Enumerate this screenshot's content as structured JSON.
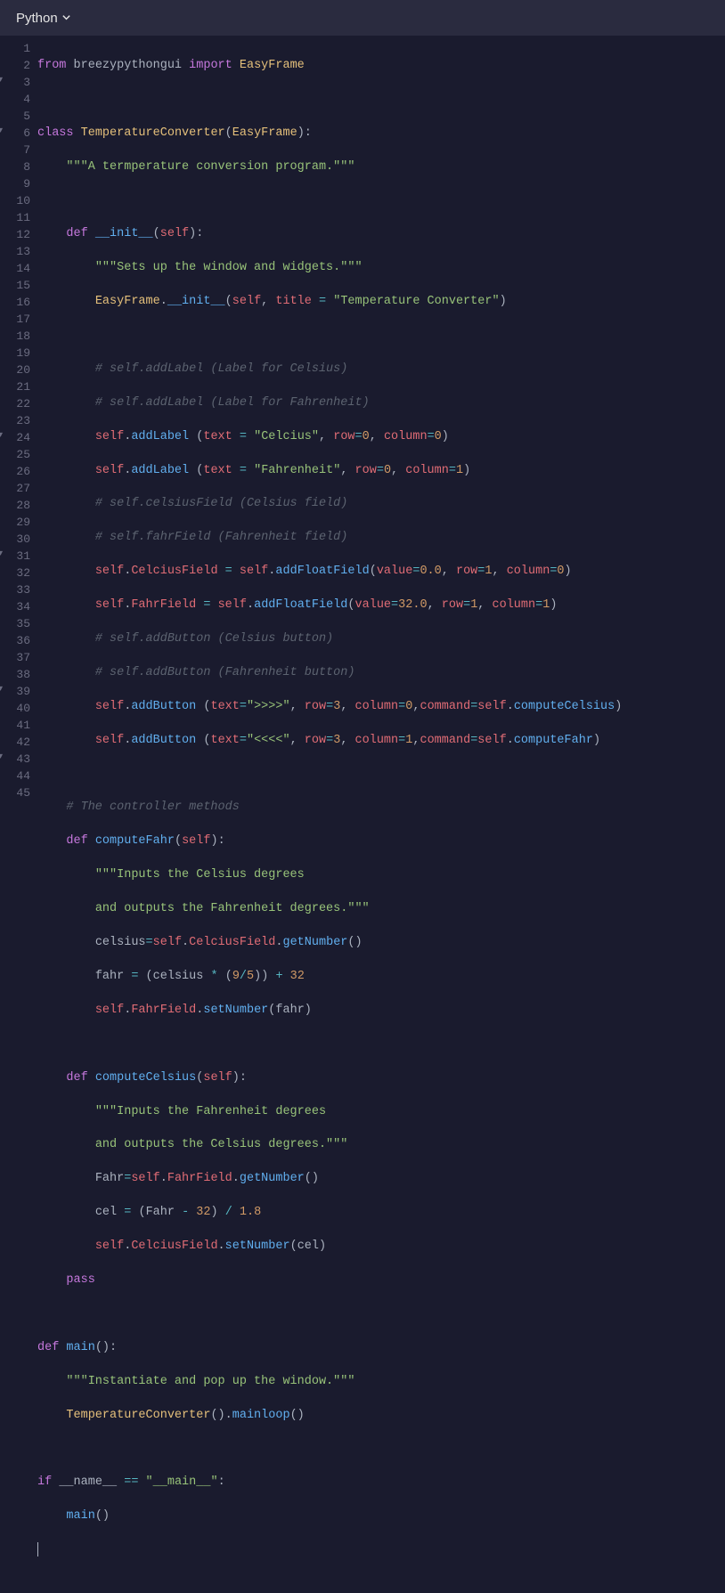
{
  "header": {
    "language_label": "Python"
  },
  "code": {
    "total_lines": 45,
    "fold_lines": [
      3,
      6,
      24,
      31,
      39,
      43
    ],
    "syntax": {
      "keywords": [
        "from",
        "import",
        "class",
        "def",
        "pass",
        "if"
      ],
      "class_name": "TemperatureConverter",
      "base_class": "EasyFrame",
      "module": "breezypythongui",
      "functions": [
        "__init__",
        "computeFahr",
        "computeCelsius",
        "main",
        "mainloop",
        "addLabel",
        "addFloatField",
        "addButton",
        "getNumber",
        "setNumber"
      ],
      "self": "self"
    },
    "lines": {
      "l1_from": "from",
      "l1_mod": "breezypythongui",
      "l1_imp": "import",
      "l1_cls": "EasyFrame",
      "l3_kw": "class",
      "l3_name": "TemperatureConverter",
      "l3_base": "EasyFrame",
      "l4_doc": "\"\"\"A termperature conversion program.\"\"\"",
      "l6_kw": "def",
      "l6_fn": "__init__",
      "l6_self": "self",
      "l7_doc": "\"\"\"Sets up the window and widgets.\"\"\"",
      "l8_cls": "EasyFrame",
      "l8_fn": "__init__",
      "l8_self": "self",
      "l8_param": "title",
      "l8_str": "\"Temperature Converter\"",
      "l10_c": "# self.addLabel (Label for Celsius)",
      "l11_c": "# self.addLabel (Label for Fahrenheit)",
      "l12_self": "self",
      "l12_fn": "addLabel",
      "l12_p1": "text",
      "l12_s1": "\"Celcius\"",
      "l12_p2": "row",
      "l12_n2": "0",
      "l12_p3": "column",
      "l12_n3": "0",
      "l13_self": "self",
      "l13_fn": "addLabel",
      "l13_p1": "text",
      "l13_s1": "\"Fahrenheit\"",
      "l13_p2": "row",
      "l13_n2": "0",
      "l13_p3": "column",
      "l13_n3": "1",
      "l14_c": "# self.celsiusField (Celsius field)",
      "l15_c": "# self.fahrField (Fahrenheit field)",
      "l16_self": "self",
      "l16_attr": "CelciusField",
      "l16_self2": "self",
      "l16_fn": "addFloatField",
      "l16_p1": "value",
      "l16_n1": "0.0",
      "l16_p2": "row",
      "l16_n2": "1",
      "l16_p3": "column",
      "l16_n3": "0",
      "l17_self": "self",
      "l17_attr": "FahrField",
      "l17_self2": "self",
      "l17_fn": "addFloatField",
      "l17_p1": "value",
      "l17_n1": "32.0",
      "l17_p2": "row",
      "l17_n2": "1",
      "l17_p3": "column",
      "l17_n3": "1",
      "l18_c": "# self.addButton (Celsius button)",
      "l19_c": "# self.addButton (Fahrenheit button)",
      "l20_self": "self",
      "l20_fn": "addButton",
      "l20_p1": "text",
      "l20_s1": "\">>>>\"",
      "l20_p2": "row",
      "l20_n2": "3",
      "l20_p3": "column",
      "l20_n3": "0",
      "l20_p4": "command",
      "l20_self2": "self",
      "l20_cmd": "computeCelsius",
      "l21_self": "self",
      "l21_fn": "addButton",
      "l21_p1": "text",
      "l21_s1": "\"<<<<\"",
      "l21_p2": "row",
      "l21_n2": "3",
      "l21_p3": "column",
      "l21_n3": "1",
      "l21_p4": "command",
      "l21_self2": "self",
      "l21_cmd": "computeFahr",
      "l23_c": "# The controller methods",
      "l24_kw": "def",
      "l24_fn": "computeFahr",
      "l24_self": "self",
      "l25_s": "\"\"\"Inputs the Celsius degrees",
      "l26_s": "and outputs the Fahrenheit degrees.\"\"\"",
      "l27_var": "celsius",
      "l27_self": "self",
      "l27_attr": "CelciusField",
      "l27_fn": "getNumber",
      "l28_var": "fahr",
      "l28_var2": "celsius",
      "l28_n1": "9",
      "l28_n2": "5",
      "l28_n3": "32",
      "l29_self": "self",
      "l29_attr": "FahrField",
      "l29_fn": "setNumber",
      "l29_arg": "fahr",
      "l31_kw": "def",
      "l31_fn": "computeCelsius",
      "l31_self": "self",
      "l32_s": "\"\"\"Inputs the Fahrenheit degrees",
      "l33_s": "and outputs the Celsius degrees.\"\"\"",
      "l34_var": "Fahr",
      "l34_self": "self",
      "l34_attr": "FahrField",
      "l34_fn": "getNumber",
      "l35_var": "cel",
      "l35_var2": "Fahr",
      "l35_n1": "32",
      "l35_n2": "1.8",
      "l36_self": "self",
      "l36_attr": "CelciusField",
      "l36_fn": "setNumber",
      "l36_arg": "cel",
      "l37_kw": "pass",
      "l39_kw": "def",
      "l39_fn": "main",
      "l40_s": "\"\"\"Instantiate and pop up the window.\"\"\"",
      "l41_cls": "TemperatureConverter",
      "l41_fn": "mainloop",
      "l43_kw": "if",
      "l43_var": "__name__",
      "l43_s": "\"__main__\"",
      "l44_fn": "main"
    }
  }
}
